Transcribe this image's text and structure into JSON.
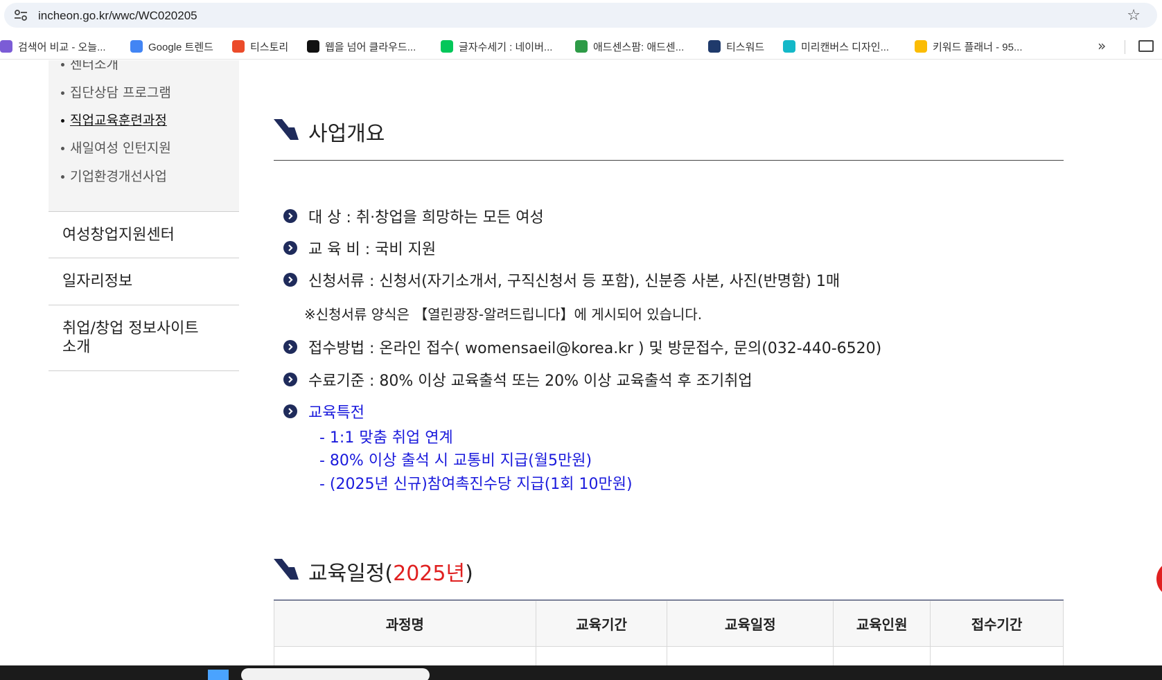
{
  "browser": {
    "url": "incheon.go.kr/wwc/WC020205",
    "bookmarks": [
      {
        "label": "검색어 비교 - 오늘...",
        "color": "#7b5cd6",
        "icon": "puzzle-icon"
      },
      {
        "label": "Google 트렌드",
        "color": "#4285f4",
        "icon": "trends-icon"
      },
      {
        "label": "티스토리",
        "color": "#eb4b2a",
        "icon": "tistory-icon"
      },
      {
        "label": "웹을 넘어 클라우드...",
        "color": "#111111",
        "icon": "g-icon"
      },
      {
        "label": "글자수세기 : 네이버...",
        "color": "#03c75a",
        "icon": "naver-icon"
      },
      {
        "label": "애드센스팜: 애드센...",
        "color": "#2e9b47",
        "icon": "adsense-icon"
      },
      {
        "label": "티스워드",
        "color": "#1f3a6b",
        "icon": "tw-icon"
      },
      {
        "label": "미리캔버스 디자인...",
        "color": "#14b8c8",
        "icon": "miricanvas-icon"
      },
      {
        "label": "키워드 플래너 - 95...",
        "color": "#fbbc04",
        "icon": "ads-icon"
      }
    ]
  },
  "sidebar": {
    "sub_items": [
      {
        "label": "센터소개",
        "active": false
      },
      {
        "label": "집단상담 프로그램",
        "active": false
      },
      {
        "label": "직업교육훈련과정",
        "active": true
      },
      {
        "label": "새일여성 인턴지원",
        "active": false
      },
      {
        "label": "기업환경개선사업",
        "active": false
      }
    ],
    "menu": [
      {
        "label": "여성창업지원센터"
      },
      {
        "label": "일자리정보"
      },
      {
        "label": "취업/창업 정보사이트\n소개"
      }
    ]
  },
  "overview": {
    "title": "사업개요",
    "rows": [
      "대 상 : 취·창업을 희망하는 모든 여성",
      "교 육 비 : 국비 지원",
      "신청서류 : 신청서(자기소개서, 구직신청서 등 포함), 신분증 사본, 사진(반명함) 1매"
    ],
    "note": "※신청서류 양식은 【열린광장-알려드립니다】에 게시되어 있습니다.",
    "rows2": [
      "접수방법 : 온라인 접수( womensaeil@korea.kr ) 및 방문접수, 문의(032-440-6520)",
      "수료기준 : 80% 이상 교육출석 또는 20% 이상 교육출석 후 조기취업"
    ],
    "benefits_title": "교육특전",
    "benefits": [
      "- 1:1 맞춤 취업 연계",
      "- 80% 이상 출석 시 교통비 지급(월5만원)",
      "- (2025년 신규)참여촉진수당 지급(1회 10만원)"
    ]
  },
  "schedule": {
    "title_prefix": "교육일정(",
    "year": "2025년",
    "title_suffix": ")",
    "columns": [
      "과정명",
      "교육기간",
      "교육일정",
      "교육인원",
      "접수기간"
    ]
  },
  "colors": {
    "navy": "#1f2b5b",
    "blue_text": "#1a1adc",
    "red_accent": "#e02020"
  }
}
